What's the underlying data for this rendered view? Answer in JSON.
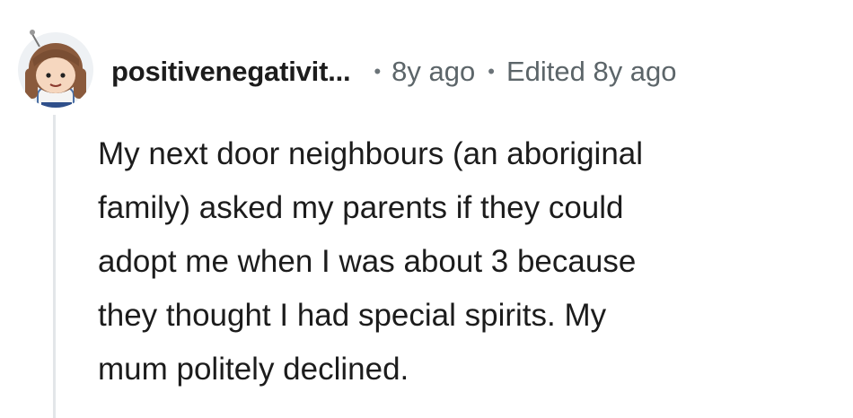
{
  "comment": {
    "author": "positivenegativit...",
    "time": "8y ago",
    "edited": "Edited 8y ago",
    "body": "My next door neighbours (an aboriginal\nfamily) asked my parents if they could\nadopt me when I was about 3 because\nthey thought I had special spirits. My\nmum politely declined."
  },
  "icons": {
    "avatar": "user-avatar-icon"
  },
  "colors": {
    "text": "#1c1c1c",
    "meta": "#5c6569",
    "thread_line": "#e3e6e9"
  }
}
